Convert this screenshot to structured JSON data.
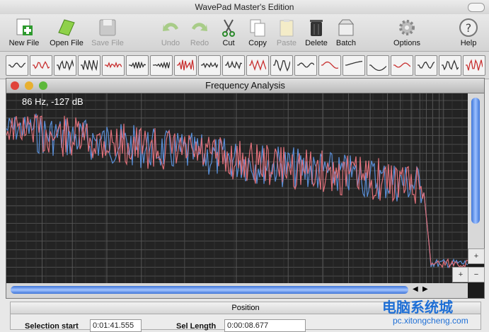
{
  "app_title": "WavePad Master's Edition",
  "toolbar": [
    {
      "label": "New File",
      "icon": "new-file-icon",
      "dim": false
    },
    {
      "label": "Open File",
      "icon": "open-file-icon",
      "dim": false
    },
    {
      "label": "Save File",
      "icon": "save-file-icon",
      "dim": true
    },
    {
      "label": "Undo",
      "icon": "undo-icon",
      "dim": true
    },
    {
      "label": "Redo",
      "icon": "redo-icon",
      "dim": true
    },
    {
      "label": "Cut",
      "icon": "cut-icon",
      "dim": false
    },
    {
      "label": "Copy",
      "icon": "copy-icon",
      "dim": false
    },
    {
      "label": "Paste",
      "icon": "paste-icon",
      "dim": true
    },
    {
      "label": "Delete",
      "icon": "delete-icon",
      "dim": false
    },
    {
      "label": "Batch",
      "icon": "batch-icon",
      "dim": false
    },
    {
      "label": "Options",
      "icon": "options-gear-icon",
      "dim": false
    },
    {
      "label": "Help",
      "icon": "help-icon",
      "dim": false
    }
  ],
  "effects": [
    "normalize-icon",
    "amplify-icon",
    "compress-icon",
    "noise-icon",
    "silence-icon",
    "fade-in-icon",
    "fade-out-icon",
    "echo-icon",
    "reverb-icon",
    "reverse-icon",
    "pitch-icon",
    "speed-icon",
    "envelope-icon",
    "equalizer-icon",
    "filter-icon",
    "frequency-icon",
    "tempo-icon",
    "spectrum-icon",
    "delay-icon",
    "chorus-icon"
  ],
  "window": {
    "title": "Frequency Analysis",
    "readout": "86 Hz, -127 dB",
    "zoom_in": "+",
    "zoom_out": "−",
    "colors": {
      "background": "#232323",
      "grid": "#5a5a5a",
      "series_left": "#e0707a",
      "series_right": "#5a8fd8"
    }
  },
  "position_panel": {
    "title": "Position",
    "selection_start_label": "Selection start",
    "selection_start_value": "0:01:41.555",
    "sel_length_label": "Sel Length",
    "sel_length_value": "0:00:08.677"
  },
  "watermark": {
    "line1": "电脑系统城",
    "line2": "pc.xitongcheng.com"
  }
}
